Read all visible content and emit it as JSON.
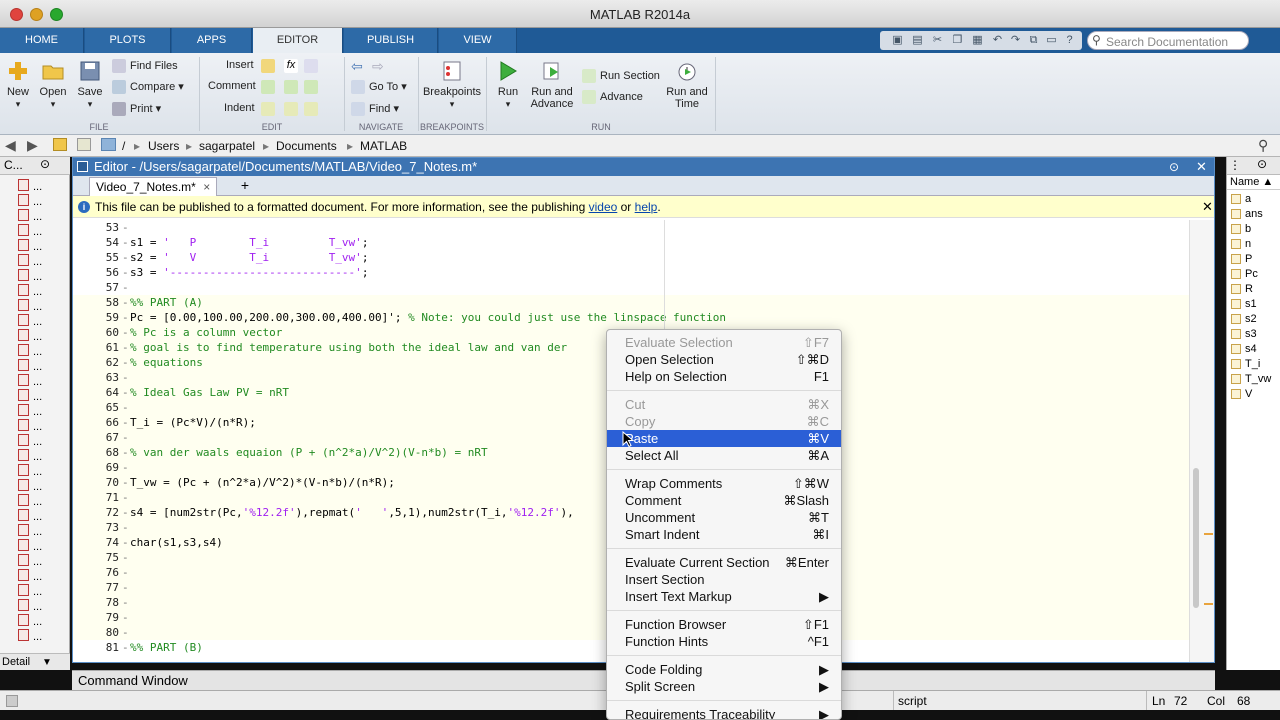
{
  "app": {
    "title": "MATLAB R2014a"
  },
  "tabs": [
    "HOME",
    "PLOTS",
    "APPS",
    "EDITOR",
    "PUBLISH",
    "VIEW"
  ],
  "search": {
    "placeholder": "Search Documentation"
  },
  "ribbon": {
    "file": {
      "label": "FILE",
      "new": "New",
      "open": "Open",
      "save": "Save",
      "find_files": "Find Files",
      "compare": "Compare",
      "print": "Print"
    },
    "edit": {
      "label": "EDIT",
      "insert": "Insert",
      "comment": "Comment",
      "indent": "Indent"
    },
    "navigate": {
      "label": "NAVIGATE",
      "go_to": "Go To",
      "find": "Find"
    },
    "breakpoints": {
      "label": "BREAKPOINTS",
      "breakpoints": "Breakpoints"
    },
    "run": {
      "label": "RUN",
      "run": "Run",
      "run_and_advance": "Run and Advance",
      "run_section": "Run Section",
      "advance": "Advance",
      "run_and_time": "Run and Time"
    }
  },
  "path": [
    "Users",
    "sagarpatel",
    "Documents",
    "MATLAB"
  ],
  "left_panel": {
    "header": "C...",
    "detail_label": "Detail"
  },
  "editor": {
    "title": "Editor - /Users/sagarpatel/Documents/MATLAB/Video_7_Notes.m*",
    "tab": "Video_7_Notes.m*",
    "notice": {
      "text": "This file can be published to a formatted document. For more information, see the publishing ",
      "link1": "video",
      "or": " or ",
      "link2": "help",
      "end": "."
    }
  },
  "code_lines": [
    {
      "n": "53",
      "t": ""
    },
    {
      "n": "54",
      "t": "s1 = '   P        T_i         T_vw';"
    },
    {
      "n": "55",
      "t": "s2 = '   V        T_i         T_vw';"
    },
    {
      "n": "56",
      "t": "s3 = '----------------------------';"
    },
    {
      "n": "57",
      "t": ""
    },
    {
      "n": "58",
      "t": "%% PART (A)"
    },
    {
      "n": "59",
      "t": "Pc = [0.00,100.00,200.00,300.00,400.00]'; % Note: you could just use the linspace function"
    },
    {
      "n": "60",
      "t": "% Pc is a column vector"
    },
    {
      "n": "61",
      "t": "% goal is to find temperature using both the ideal law and van der"
    },
    {
      "n": "62",
      "t": "% equations"
    },
    {
      "n": "63",
      "t": ""
    },
    {
      "n": "64",
      "t": "% Ideal Gas Law PV = nRT"
    },
    {
      "n": "65",
      "t": ""
    },
    {
      "n": "66",
      "t": "T_i = (Pc*V)/(n*R);"
    },
    {
      "n": "67",
      "t": ""
    },
    {
      "n": "68",
      "t": "% van der waals equaion (P + (n^2*a)/V^2)(V-n*b) = nRT"
    },
    {
      "n": "69",
      "t": ""
    },
    {
      "n": "70",
      "t": "T_vw = (Pc + (n^2*a)/V^2)*(V-n*b)/(n*R);"
    },
    {
      "n": "71",
      "t": ""
    },
    {
      "n": "72",
      "t": "s4 = [num2str(Pc,'%12.2f'),repmat('   ',5,1),num2str(T_i,'%12.2f'),"
    },
    {
      "n": "73",
      "t": ""
    },
    {
      "n": "74",
      "t": "char(s1,s3,s4)"
    },
    {
      "n": "75",
      "t": ""
    },
    {
      "n": "76",
      "t": ""
    },
    {
      "n": "77",
      "t": ""
    },
    {
      "n": "78",
      "t": ""
    },
    {
      "n": "79",
      "t": ""
    },
    {
      "n": "80",
      "t": ""
    },
    {
      "n": "81",
      "t": "%% PART (B)"
    }
  ],
  "workspace": {
    "header": "Name ▲",
    "vars": [
      "a",
      "ans",
      "b",
      "n",
      "P",
      "Pc",
      "R",
      "s1",
      "s2",
      "s3",
      "s4",
      "T_i",
      "T_vw",
      "V"
    ]
  },
  "command_window": {
    "label": "Command Window"
  },
  "status": {
    "mode": "script",
    "ln_label": "Ln",
    "ln": "72",
    "col_label": "Col",
    "col": "68"
  },
  "context_menu": [
    {
      "label": "Evaluate Selection",
      "shortcut": "⇧F7",
      "disabled": true
    },
    {
      "label": "Open Selection",
      "shortcut": "⇧⌘D"
    },
    {
      "label": "Help on Selection",
      "shortcut": "F1"
    },
    {
      "sep": true
    },
    {
      "label": "Cut",
      "shortcut": "⌘X",
      "disabled": true
    },
    {
      "label": "Copy",
      "shortcut": "⌘C",
      "disabled": true
    },
    {
      "label": "Paste",
      "shortcut": "⌘V",
      "selected": true
    },
    {
      "label": "Select All",
      "shortcut": "⌘A"
    },
    {
      "sep": true
    },
    {
      "label": "Wrap Comments",
      "shortcut": "⇧⌘W"
    },
    {
      "label": "Comment",
      "shortcut": "⌘Slash"
    },
    {
      "label": "Uncomment",
      "shortcut": "⌘T"
    },
    {
      "label": "Smart Indent",
      "shortcut": "⌘I"
    },
    {
      "sep": true
    },
    {
      "label": "Evaluate Current Section",
      "shortcut": "⌘Enter"
    },
    {
      "label": "Insert Section",
      "shortcut": ""
    },
    {
      "label": "Insert Text Markup",
      "shortcut": "▶"
    },
    {
      "sep": true
    },
    {
      "label": "Function Browser",
      "shortcut": "⇧F1"
    },
    {
      "label": "Function Hints",
      "shortcut": "^F1"
    },
    {
      "sep": true
    },
    {
      "label": "Code Folding",
      "shortcut": "▶"
    },
    {
      "label": "Split Screen",
      "shortcut": "▶"
    },
    {
      "sep": true
    },
    {
      "label": "Requirements Traceability",
      "shortcut": "▶"
    }
  ],
  "colors": {
    "accent": "#3d74b2",
    "tabbar": "#1f5a96",
    "menu_selected": "#2b5fd6",
    "comment": "#228b22",
    "string": "#a020f0"
  }
}
